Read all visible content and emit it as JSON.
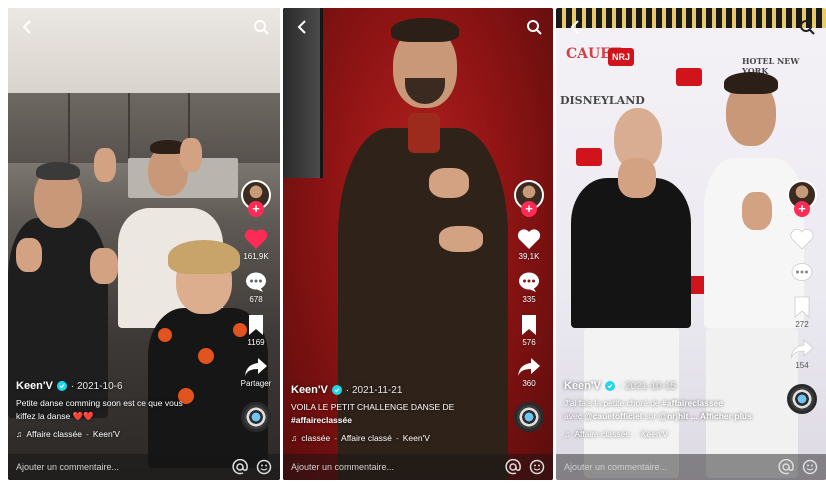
{
  "colors": {
    "accent_red": "#fe2c55",
    "verified_blue": "#20d5ec",
    "panel1_bg": "#7b6f66",
    "panel2_bg": "#8e1717",
    "panel3_bg": "#f4f2f6"
  },
  "common": {
    "comment_placeholder": "Ajouter un commentaire..."
  },
  "panels": [
    {
      "author": "Keen'V",
      "date": "2021-10-6",
      "description_line1": "Petite danse comming soon est ce que vous",
      "description_line2": "kiffez la danse",
      "emoji": "❤️❤️",
      "music_1": "Affaire classée",
      "music_2": "Keen'V",
      "likes": "161,9K",
      "comments": "678",
      "saves": "1169",
      "share_label": "Partager",
      "like_filled": true
    },
    {
      "author": "Keen'V",
      "date": "2021-11-21",
      "description_line1": "VOILA LE PETIT CHALLENGE DANSE DE",
      "hashtag": "#affaireclassée",
      "music_1": "classée",
      "music_2": "Affaire classé",
      "music_3": "Keen'V",
      "likes": "39,1K",
      "comments": "335",
      "saves": "576",
      "shares": "360",
      "like_filled": false
    },
    {
      "author": "Keen'V",
      "date": "2021-10-15",
      "description_pre": "J'ai fais la petite choré de",
      "hashtag": "#affaireclassee",
      "description_pre2": "avec",
      "mention_1": "@cauetofficiel",
      "description_mid": "sur",
      "mention_2": "@nrjhit",
      "more_label": "... Afficher plus",
      "music_1": "Affaire classée",
      "music_2": "Keen'V",
      "likes": "",
      "comments": "",
      "saves": "272",
      "shares": "154",
      "like_filled": false,
      "wall_text_1": "CAUET",
      "wall_text_2": "NRJ",
      "wall_text_3": "DISNEYLAND",
      "wall_text_4": "HOTEL NEW YORK"
    }
  ]
}
